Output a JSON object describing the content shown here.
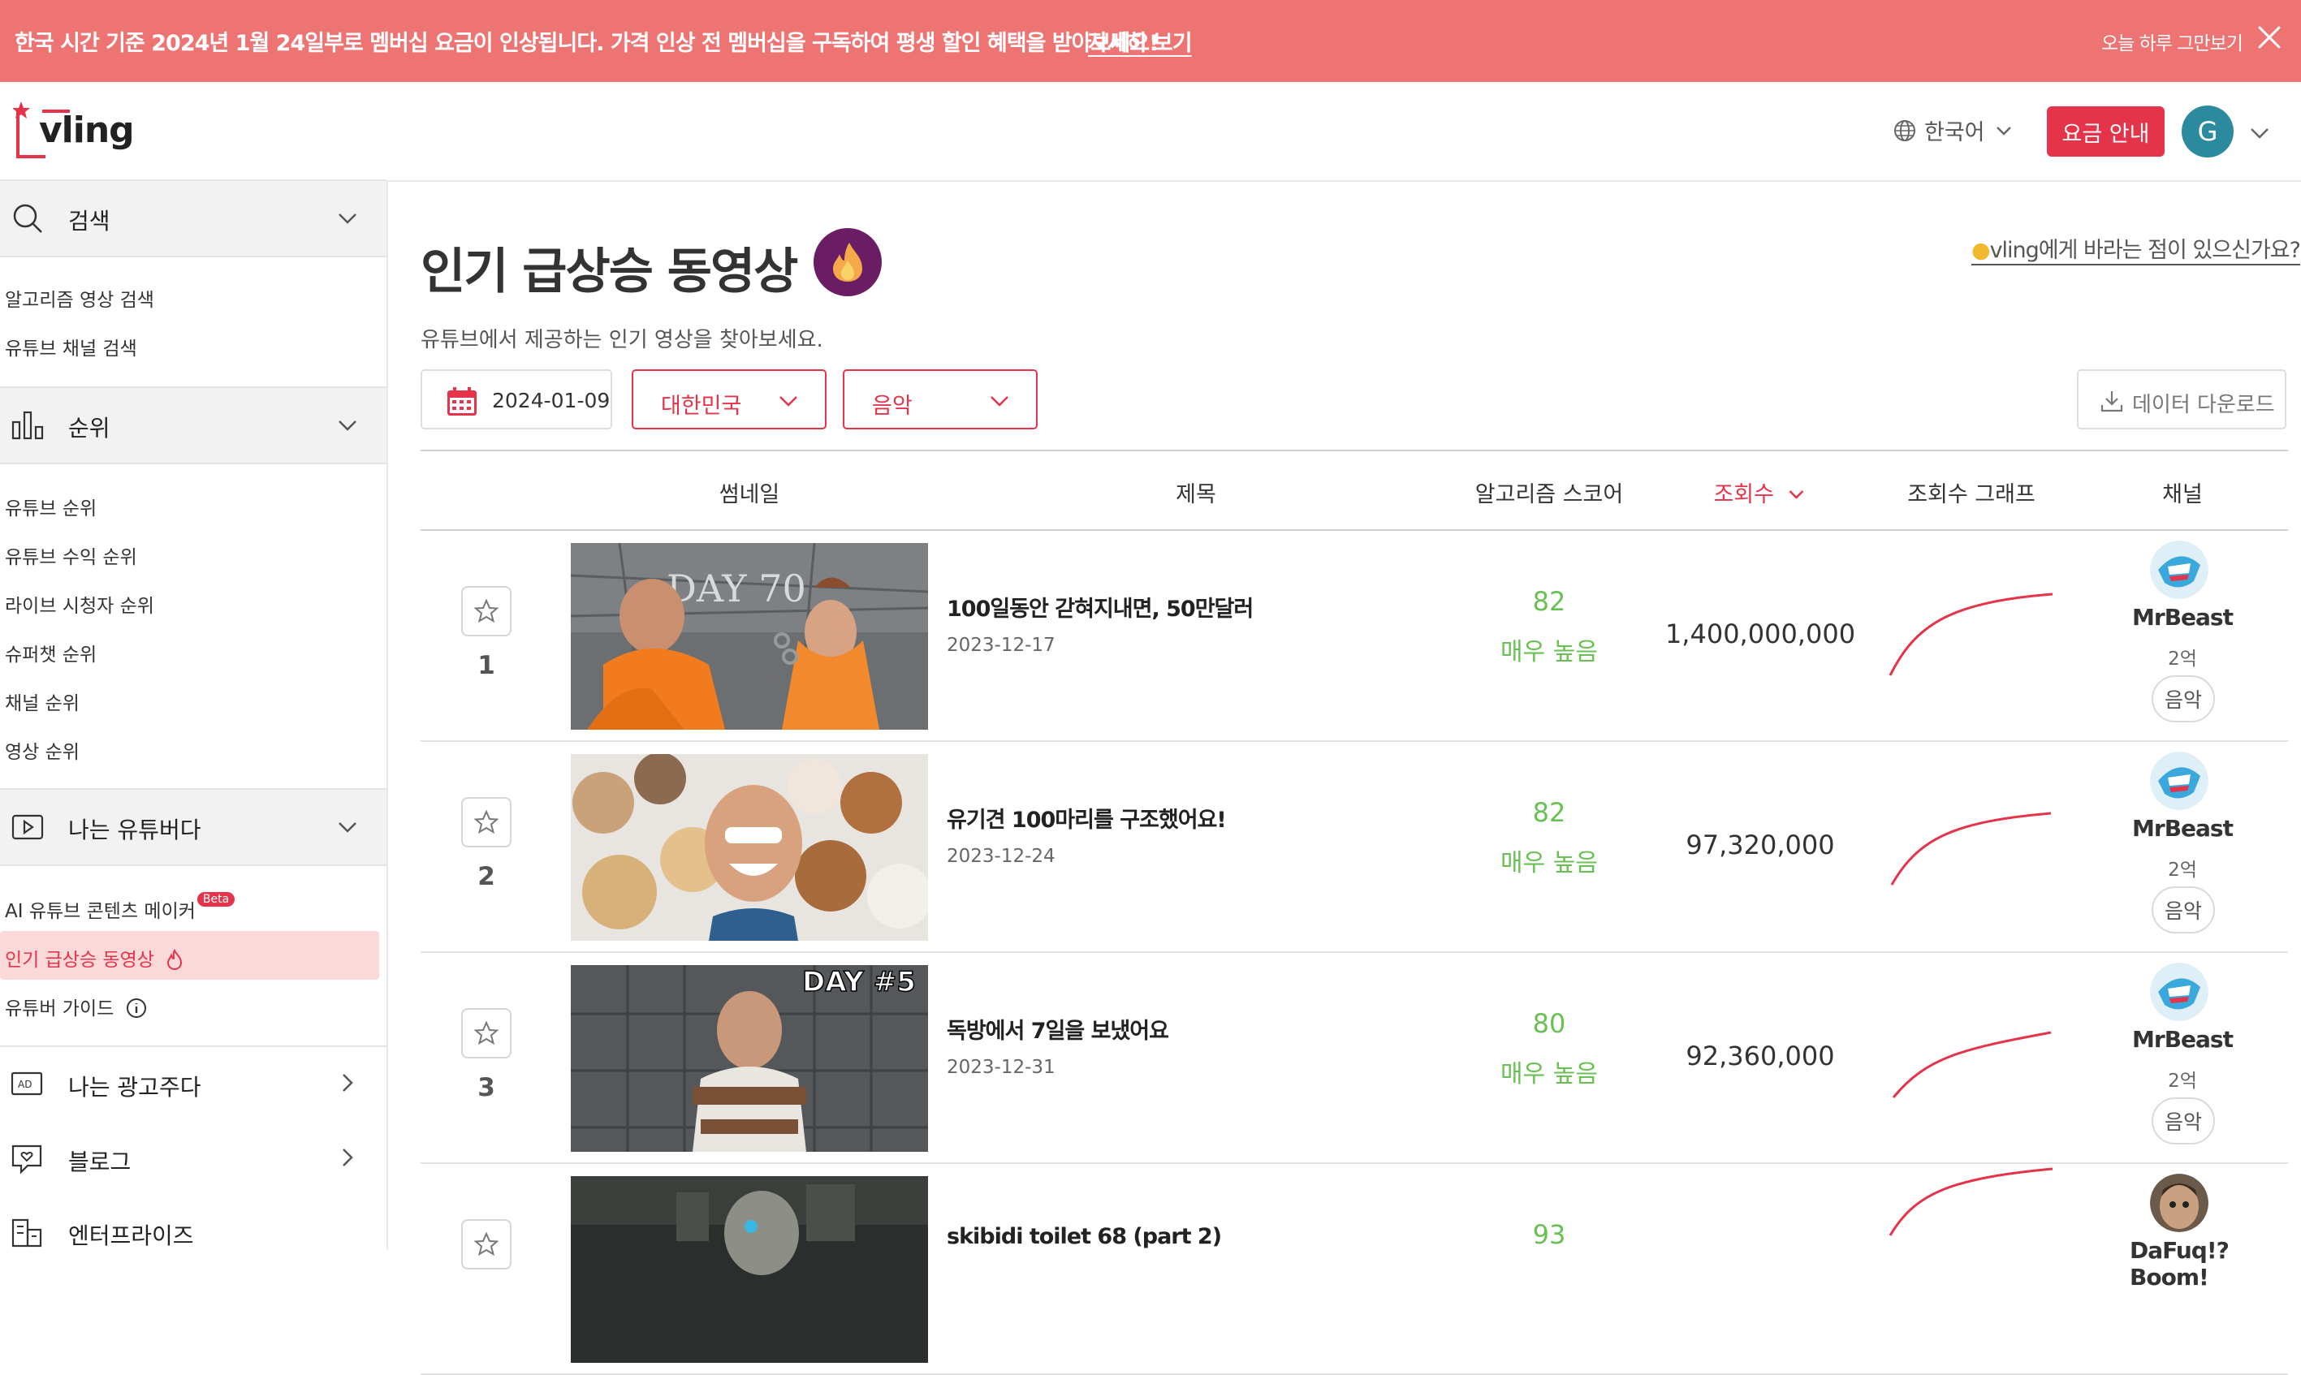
{
  "banner": {
    "message": "한국 시간 기준 2024년 1월 24일부로 멤버십 요금이 인상됩니다. 가격 인상 전 멤버십을 구독하여 평생 할인 혜택을 받아보세요!",
    "link": "자세히 보기",
    "dismiss": "오늘 하루 그만보기",
    "background": "#ee7373"
  },
  "header": {
    "logo": "vling",
    "language": "한국어",
    "pricing_button": "요금 안내",
    "avatar_letter": "G",
    "accent": "#e5334a"
  },
  "sidebar": {
    "search": {
      "title": "검색",
      "items": [
        "알고리즘 영상 검색",
        "유튜브 채널 검색"
      ]
    },
    "ranking": {
      "title": "순위",
      "items": [
        "유튜브 순위",
        "유튜브 수익 순위",
        "라이브 시청자 순위",
        "슈퍼챗 순위",
        "채널 순위",
        "영상 순위"
      ]
    },
    "youtuber": {
      "title": "나는 유튜버다",
      "items": [
        "AI 유튜브 콘텐츠 메이커",
        "인기 급상승 동영상",
        "유튜버 가이드"
      ],
      "beta": "Beta",
      "active_index": 1
    },
    "advertiser": "나는 광고주다",
    "blog": "블로그",
    "enterprise": "엔터프라이즈"
  },
  "main": {
    "title": "인기 급상승 동영상",
    "subtitle": "유튜브에서 제공하는 인기 영상을 찾아보세요.",
    "feedback": "vling에게 바라는 점이 있으신가요?",
    "filters": {
      "date": "2024-01-09",
      "country": "대한민국",
      "category": "음악"
    },
    "download": "데이터 다운로드",
    "columns": [
      "썸네일",
      "제목",
      "알고리즘 스코어",
      "조회수",
      "조회수 그래프",
      "채널"
    ],
    "rows": [
      {
        "rank": "1",
        "title": "100일동안 갇혀지내면, 50만달러",
        "date": "2023-12-17",
        "score": "82",
        "score_label": "매우 높음",
        "views": "1,400,000,000",
        "channel": "MrBeast",
        "subs": "2억",
        "category": "음악"
      },
      {
        "rank": "2",
        "title": "유기견 100마리를 구조했어요!",
        "date": "2023-12-24",
        "score": "82",
        "score_label": "매우 높음",
        "views": "97,320,000",
        "channel": "MrBeast",
        "subs": "2억",
        "category": "음악"
      },
      {
        "rank": "3",
        "title": "독방에서 7일을 보냈어요",
        "date": "2023-12-31",
        "score": "80",
        "score_label": "매우 높음",
        "views": "92,360,000",
        "channel": "MrBeast",
        "subs": "2억",
        "category": "음악"
      },
      {
        "rank": "",
        "title": "skibidi toilet 68 (part 2)",
        "date": "",
        "score": "93",
        "score_label": "",
        "views": "",
        "channel": "DaFuq!?Boom!",
        "subs": "",
        "category": ""
      }
    ],
    "thumb_text": [
      "DAY 70",
      "DAY #5"
    ]
  }
}
